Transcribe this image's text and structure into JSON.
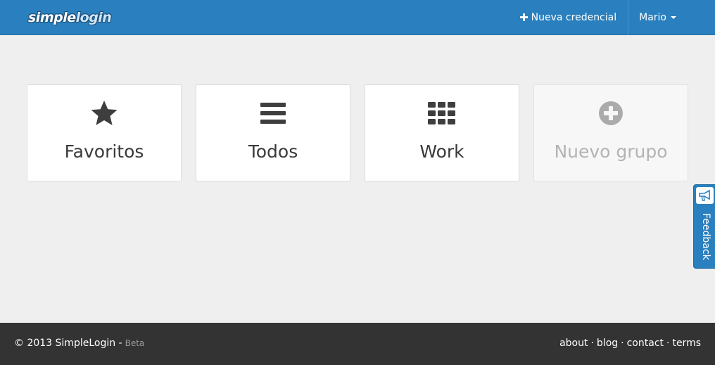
{
  "navbar": {
    "logo_simple": "simple",
    "logo_login": "login",
    "new_credential_icon": "plus-icon",
    "new_credential_label": "Nueva credencial",
    "user_label": "Mario"
  },
  "cards": [
    {
      "label": "Favoritos",
      "icon": "star-icon"
    },
    {
      "label": "Todos",
      "icon": "list-icon"
    },
    {
      "label": "Work",
      "icon": "grid-icon"
    },
    {
      "label": "Nuevo grupo",
      "icon": "plus-circle-icon"
    }
  ],
  "feedback": {
    "label": "Feedback",
    "icon": "megaphone-icon"
  },
  "footer": {
    "copyright": "© 2013 SimpleLogin -",
    "beta": "Beta",
    "links": [
      "about",
      "blog",
      "contact",
      "terms"
    ],
    "separator": "·"
  },
  "colors": {
    "brand_blue": "#2a80be",
    "footer_bg": "#333333",
    "page_bg": "#efefef"
  }
}
